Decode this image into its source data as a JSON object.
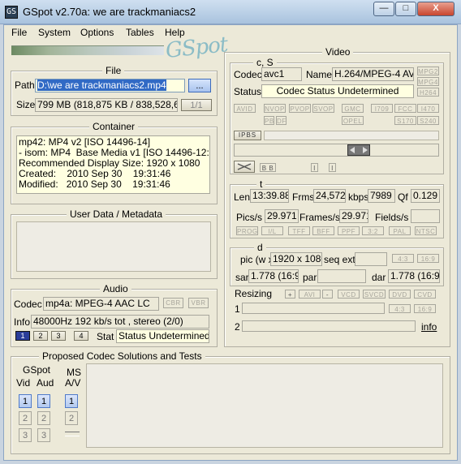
{
  "window": {
    "title": "GSpot v2.70a: we are trackmaniacs2",
    "icon_label": "GS",
    "min_label": "—",
    "max_label": "□",
    "close_label": "X"
  },
  "menu": [
    "File",
    "System",
    "Options",
    "Tables",
    "Help"
  ],
  "logo": "GSpot",
  "file": {
    "title": "File",
    "path_label": "Path",
    "path_value": "D:\\we are trackmaniacs2.mp4",
    "browse_label": "...",
    "size_label": "Size",
    "size_value": "799 MB (818,875 KB / 838,528,633",
    "count": "1/1"
  },
  "container": {
    "title": "Container",
    "lines": "mp42: MP4 v2 [ISO 14496-14]\n- isom: MP4  Base Media v1 [ISO 14496-12:2003]\nRecommended Display Size: 1920 x 1080\nCreated:    2010 Sep 30    19:31:46\nModified:   2010 Sep 30    19:31:46"
  },
  "userdata": {
    "title": "User Data / Metadata"
  },
  "audio": {
    "title": "Audio",
    "codec_label": "Codec",
    "codec_value": "mp4a: MPEG-4 AAC LC",
    "cbr": "CBR",
    "vbr": "VBR",
    "info_label": "Info",
    "info_value": "48000Hz  192 kb/s tot , stereo (2/0)",
    "stream_btns": [
      "1",
      "2",
      "3",
      "4"
    ],
    "stat_label": "Stat",
    "stat_value": "Status Undetermined"
  },
  "video": {
    "title": "Video",
    "cs_title": "c, S",
    "codec_label": "Codec",
    "codec_value": "avc1",
    "name_label": "Name",
    "name_value": "H.264/MPEG-4 AVC",
    "mpeg_btns": [
      "MPG2",
      "MPG4",
      "H264"
    ],
    "status_label": "Status",
    "status_value": "Codec Status Undetermined",
    "row1": [
      "AVID",
      "NVOP",
      "PVOP",
      "SVOP",
      "GMC",
      "I709",
      "FCC",
      "I470"
    ],
    "row2": [
      "PB",
      "DF",
      "OPEL",
      "S170",
      "S240"
    ],
    "frame_chars": [
      "I",
      "P",
      "B",
      "S"
    ],
    "t_title": "t",
    "len_label": "Len",
    "len_value": "13:39.885",
    "frms_label": "Frms",
    "frms_value": "24,572",
    "kbps_label": "kbps",
    "kbps_value": "7989",
    "qf_label": "Qf",
    "qf_value": "0.129",
    "pics_label": "Pics/s",
    "pics_value": "29.971",
    "frames_label": "Frames/s",
    "frames_value": "29.971",
    "fields_label": "Fields/s",
    "fields_value": "",
    "trow": [
      "PROG",
      "I/L",
      "TFF",
      "BFF",
      "PPF",
      "3:2",
      "PAL",
      "NTSC"
    ],
    "d_title": "d",
    "pic_label": "pic (w x",
    "pic_value": "1920 x 1080",
    "seqext_label": "seq ext",
    "ratio_btns": [
      "4:3",
      "16:9"
    ],
    "sar_label": "sar",
    "sar_value": "1.778 (16:9)",
    "par_label": "par",
    "par_value": "",
    "dar_label": "dar",
    "dar_value": "1.778 (16:9)",
    "resizing_label": "Resizing",
    "plus": "+",
    "avi": "AVI",
    "minus": "-",
    "res_btns": [
      "VCD",
      "SVCD",
      "DVD",
      "CVD"
    ],
    "row_1": "1",
    "row_2": "2",
    "info_link": "info"
  },
  "proposed": {
    "title": "Proposed Codec Solutions and Tests",
    "gspot_label": "GSpot",
    "vid_label": "Vid",
    "aud_label": "Aud",
    "ms_label": "MS",
    "av_label": "A/V",
    "nums": [
      "1",
      "2",
      "3"
    ]
  }
}
